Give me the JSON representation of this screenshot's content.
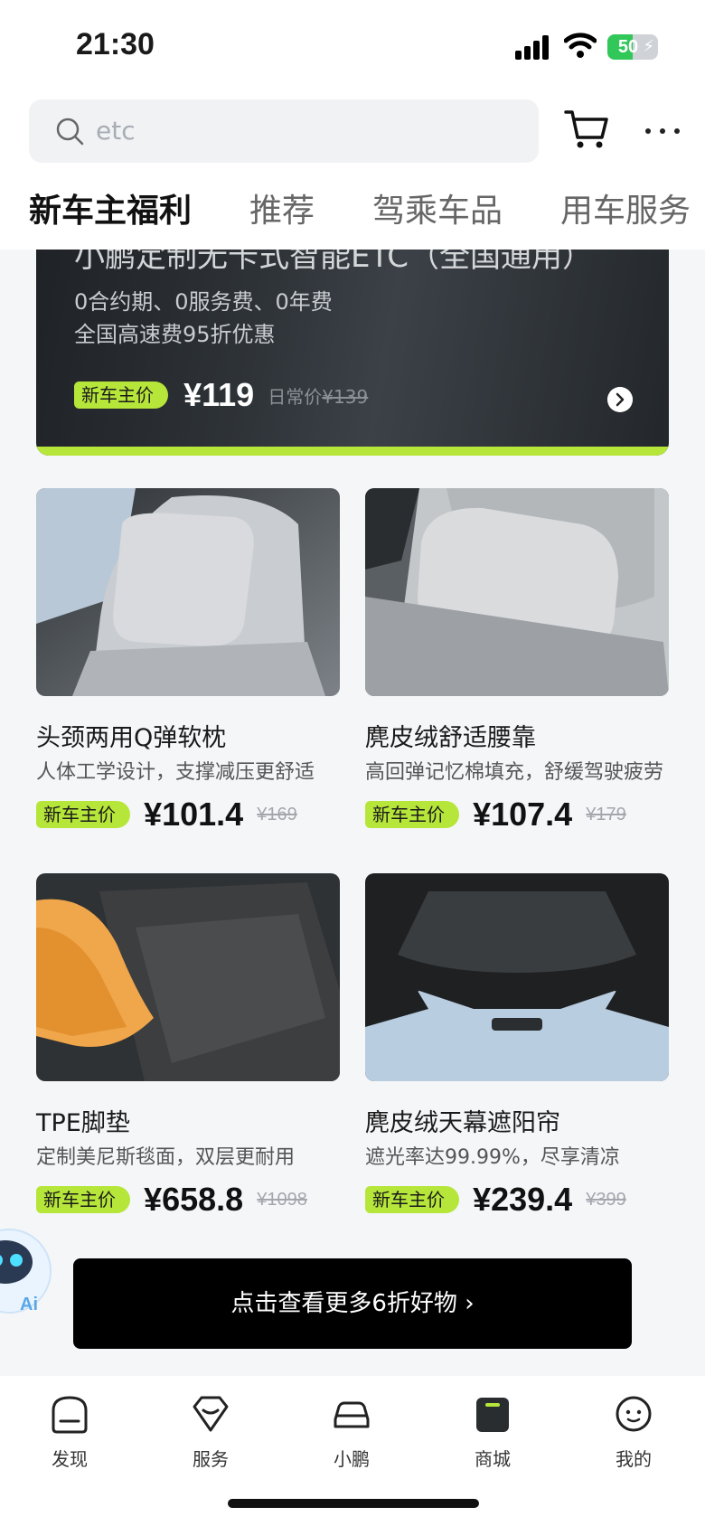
{
  "status_bar": {
    "time": "21:30",
    "battery": "50",
    "battery_level": 0.5
  },
  "search": {
    "placeholder": "etc"
  },
  "tabs": [
    {
      "label": "新车主福利",
      "active": true
    },
    {
      "label": "推荐",
      "active": false
    },
    {
      "label": "驾乘车品",
      "active": false
    },
    {
      "label": "用车服务",
      "active": false
    }
  ],
  "etc_banner": {
    "title": "小鹏定制无卡式智能ETC（全国通用）",
    "line1": "0合约期、0服务费、0年费",
    "line2": "全国高速费95折优惠",
    "badge": "新车主价",
    "price": "¥119",
    "orig_prefix": "日常价",
    "orig_price": "¥139"
  },
  "products": [
    {
      "name": "头颈两用Q弹软枕",
      "desc": "人体工学设计，支撑减压更舒适",
      "badge": "新车主价",
      "price": "¥101.4",
      "orig": "¥169"
    },
    {
      "name": "麂皮绒舒适腰靠",
      "desc": "高回弹记忆棉填充，舒缓驾驶疲劳",
      "badge": "新车主价",
      "price": "¥107.4",
      "orig": "¥179"
    },
    {
      "name": "TPE脚垫",
      "desc": "定制美尼斯毯面，双层更耐用",
      "badge": "新车主价",
      "price": "¥658.8",
      "orig": "¥1098"
    },
    {
      "name": "麂皮绒天幕遮阳帘",
      "desc": "遮光率达99.99%，尽享清凉",
      "badge": "新车主价",
      "price": "¥239.4",
      "orig": "¥399"
    }
  ],
  "cta": {
    "label": "点击查看更多6折好物 ›"
  },
  "ai_bubble": {
    "label": "Ai"
  },
  "bottom_nav": [
    {
      "label": "发现",
      "icon": "discover-icon"
    },
    {
      "label": "服务",
      "icon": "service-icon"
    },
    {
      "label": "小鹏",
      "icon": "car-icon"
    },
    {
      "label": "商城",
      "icon": "mall-icon",
      "active": true
    },
    {
      "label": "我的",
      "icon": "profile-icon"
    }
  ],
  "colors": {
    "accent": "#b6e63a",
    "cta_bg": "#000000"
  }
}
